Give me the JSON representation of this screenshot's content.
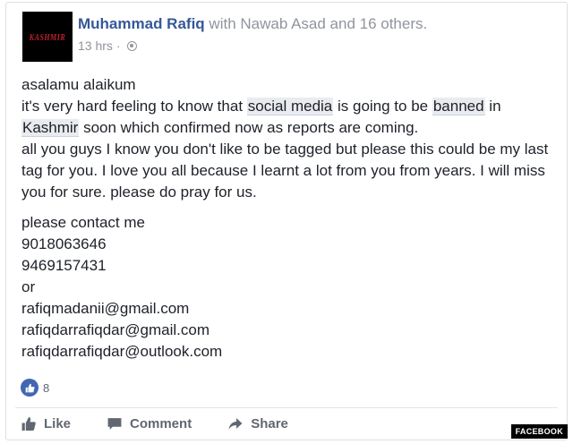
{
  "post": {
    "avatar_text": "KASHMIR",
    "author": "Muhammad Rafiq",
    "with_text": " with Nawab Asad and 16 others.",
    "time": "13 hrs",
    "separator": " · ",
    "privacy_icon": "globe-icon",
    "lines": {
      "l1": "asalamu alaikum",
      "l2a": "it's very hard feeling to know that ",
      "l2_tag1": "social media",
      "l2b": " is going to be ",
      "l2_tag2": "banned",
      "l2c": " in",
      "l3_tag": "Kashmir",
      "l3b": " soon which confirmed now as reports are coming.",
      "p2": "all you guys I know you don't like to be tagged but please this could be my last tag for you. I love you all because I learnt a lot from you from years. I will miss you for sure. please do pray for us.",
      "c1": "please contact me",
      "c2": "9018063646",
      "c3": "9469157431",
      "c4": "or",
      "c5": "rafiqmadanii@gmail.com",
      "c6": "rafiqdarrafiqdar@gmail.com",
      "c7": "rafiqdarrafiqdar@outlook.com"
    },
    "like_count": "8"
  },
  "actions": {
    "like": "Like",
    "comment": "Comment",
    "share": "Share"
  },
  "watermark": "FACEBOOK",
  "colors": {
    "link": "#365899",
    "meta": "#90949c",
    "like_blue": "#4267b2"
  }
}
